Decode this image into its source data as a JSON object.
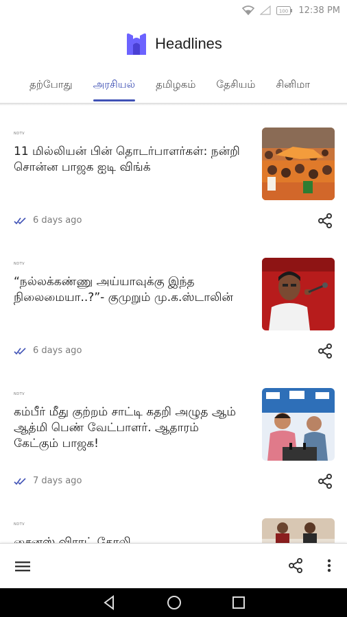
{
  "status_bar": {
    "time": "12:38 PM",
    "battery": "100"
  },
  "app": {
    "title": "Headlines",
    "accent_color": "#3f51b5",
    "logo_color": "#6c63ff"
  },
  "tabs": [
    {
      "label": "தற்போது"
    },
    {
      "label": "அரசியல்"
    },
    {
      "label": "தமிழகம்"
    },
    {
      "label": "தேசியம்"
    },
    {
      "label": "சினிமா"
    }
  ],
  "active_tab": "அரசியல்",
  "articles": [
    {
      "source": "NDTV",
      "headline": "11 மில்லியன் பின் தொடர்பாளர்கள்: நன்றி சொன்ன பாஜக ஐடி விங்க்",
      "time": "6 days ago",
      "thumbnail": "crowd-photo"
    },
    {
      "source": "NDTV",
      "headline": "“நல்லக்கண்ணு அய்யாவுக்கு இந்த நிலைமையா..?”- குமுறும் மு.க.ஸ்டாலின்",
      "time": "6 days ago",
      "thumbnail": "speaker-photo"
    },
    {
      "source": "NDTV",
      "headline": "கம்பீர் மீது குற்றம் சாட்டி கதறி அழுத ஆம் ஆத்மி பெண் வேட்பாளர். ஆதாரம் கேட்கும் பாஜக!",
      "time": "7 days ago",
      "thumbnail": "press-conference-photo"
    },
    {
      "source": "NDTV",
      "headline": "சைனஸ் விராட் கோலி...",
      "time": "",
      "thumbnail": "group-photo"
    }
  ]
}
